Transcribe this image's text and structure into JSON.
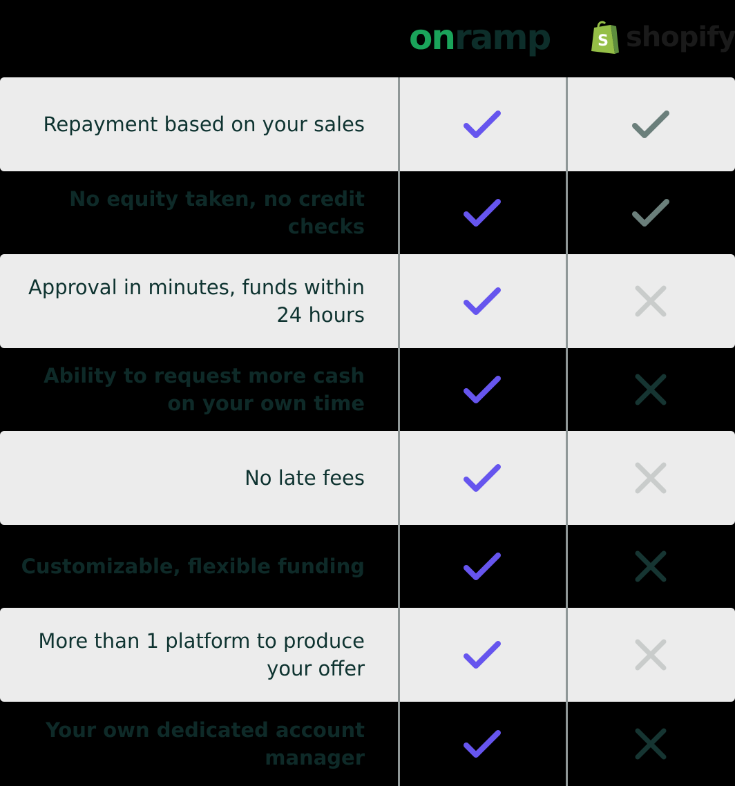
{
  "header": {
    "onramp_logo": {
      "part1": "on",
      "part2": "ramp"
    },
    "shopify_logo": {
      "word": "shopify",
      "bag_letter": "S"
    }
  },
  "rows": [
    {
      "label": "Repayment based on your sales",
      "onramp": "check",
      "shopify": "check"
    },
    {
      "label": "No equity taken, no credit checks",
      "onramp": "check",
      "shopify": "check"
    },
    {
      "label": "Approval in minutes, funds within 24 hours",
      "onramp": "check",
      "shopify": "cross"
    },
    {
      "label": "Ability to request more cash on your own time",
      "onramp": "check",
      "shopify": "cross"
    },
    {
      "label": "No late fees",
      "onramp": "check",
      "shopify": "cross"
    },
    {
      "label": "Customizable, flexible funding",
      "onramp": "check",
      "shopify": "cross"
    },
    {
      "label": "More than 1 platform to produce your offer",
      "onramp": "check",
      "shopify": "cross"
    },
    {
      "label": "Your own dedicated account manager",
      "onramp": "check",
      "shopify": "cross"
    }
  ],
  "colors": {
    "check_onramp": "#6655ee",
    "check_shopify": "#6b7f7b",
    "cross_light": "#c9cccb",
    "cross_dark": "#163532",
    "row_light": "#ececec",
    "row_dark": "#000000",
    "onramp_green": "#1aa35a",
    "shopify_green": "#95bf47"
  }
}
